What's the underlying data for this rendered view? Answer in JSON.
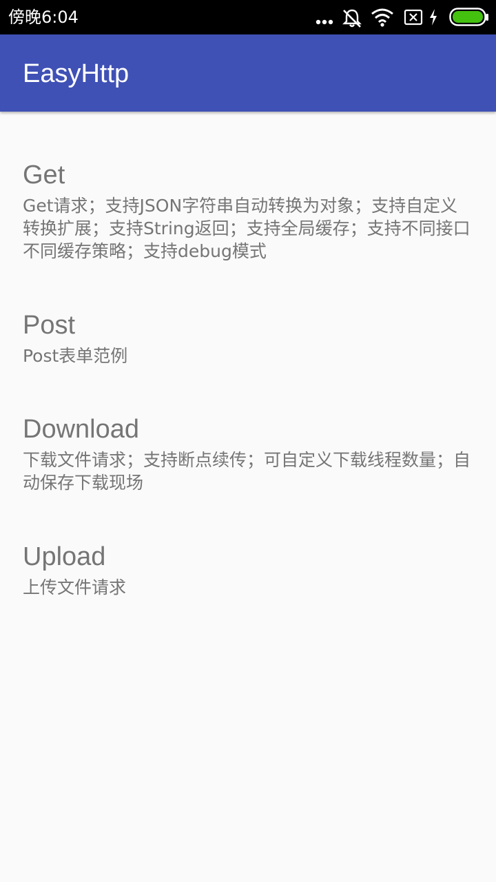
{
  "status_bar": {
    "time": "傍晚6:04",
    "icons": [
      "more-dots-icon",
      "silent-mode-icon",
      "wifi-icon",
      "no-sim-icon",
      "charging-icon",
      "battery-icon"
    ],
    "battery_color": "#44c00f"
  },
  "app_bar": {
    "title": "EasyHttp",
    "color": "#3f51b5"
  },
  "items": [
    {
      "title": "Get",
      "description": "Get请求；支持JSON字符串自动转换为对象；支持自定义转换扩展；支持String返回；支持全局缓存；支持不同接口不同缓存策略；支持debug模式"
    },
    {
      "title": "Post",
      "description": "Post表单范例"
    },
    {
      "title": "Download",
      "description": "下载文件请求；支持断点续传；可自定义下载线程数量；自动保存下载现场"
    },
    {
      "title": "Upload",
      "description": "上传文件请求"
    }
  ]
}
